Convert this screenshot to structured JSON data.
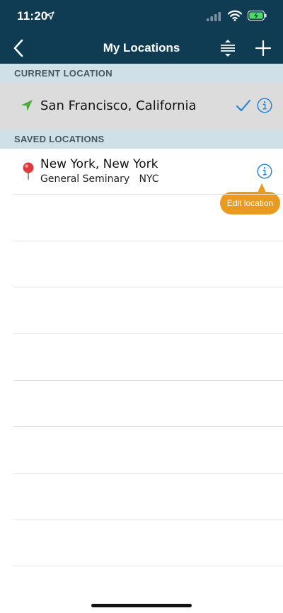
{
  "status_bar": {
    "time": "11:20"
  },
  "nav": {
    "title": "My Locations"
  },
  "sections": {
    "current": {
      "label": "CURRENT LOCATION",
      "location_name": "San Francisco, California"
    },
    "saved": {
      "label": "SAVED LOCATIONS",
      "items": [
        {
          "name": "New York, New York",
          "subtitle": "General Seminary   NYC"
        }
      ]
    }
  },
  "tooltip": {
    "text": "Edit location"
  },
  "colors": {
    "header_bg": "#0f3c52",
    "section_bg": "#cfe0e8",
    "current_row_bg": "#dcdcdc",
    "accent_blue": "#1f7fd0",
    "nav_green": "#4caa3c",
    "pin_red": "#e23a3a",
    "tooltip_orange": "#ea9a1c"
  },
  "icons": {
    "status_location": "location-arrow-icon",
    "signal": "cell-signal-icon",
    "wifi": "wifi-icon",
    "battery": "battery-charging-icon",
    "back": "chevron-left-icon",
    "reorder": "reorder-icon",
    "add": "plus-icon",
    "current_location": "navigation-arrow-icon",
    "selected": "checkmark-icon",
    "info": "info-icon",
    "pin": "map-pin-icon"
  }
}
